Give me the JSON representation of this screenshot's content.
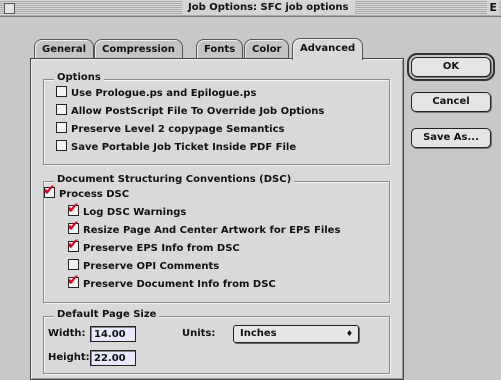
{
  "window": {
    "title": "Job Options: SFC job options",
    "zoom_glyph": "E"
  },
  "tabs": [
    {
      "label": "General"
    },
    {
      "label": "Compression"
    },
    {
      "label": "Fonts"
    },
    {
      "label": "Color"
    },
    {
      "label": "Advanced"
    }
  ],
  "options_group": {
    "title": "Options",
    "items": [
      {
        "label": "Use Prologue.ps and Epilogue.ps",
        "checked": false
      },
      {
        "label": "Allow PostScript File To Override Job Options",
        "checked": false
      },
      {
        "label": "Preserve Level 2 copypage Semantics",
        "checked": false
      },
      {
        "label": "Save Portable Job Ticket Inside PDF File",
        "checked": false
      }
    ]
  },
  "dsc_group": {
    "title": "Document Structuring Conventions (DSC)",
    "process": {
      "label": "Process DSC",
      "checked": true
    },
    "items": [
      {
        "label": "Log DSC Warnings",
        "checked": true
      },
      {
        "label": "Resize Page And Center Artwork for EPS Files",
        "checked": true
      },
      {
        "label": "Preserve EPS Info from DSC",
        "checked": true
      },
      {
        "label": "Preserve OPI Comments",
        "checked": false
      },
      {
        "label": "Preserve Document Info from DSC",
        "checked": true
      }
    ]
  },
  "page_size_group": {
    "title": "Default Page Size",
    "width_label": "Width:",
    "width_value": "14.00",
    "height_label": "Height:",
    "height_value": "22.00",
    "units_label": "Units:",
    "units_value": "Inches",
    "units_arrow": "♦"
  },
  "buttons": {
    "ok": "OK",
    "cancel": "Cancel",
    "save_as": "Save As..."
  },
  "check_glyph": "✔",
  "colors": {
    "check": "#d8001c",
    "field_bg": "#e8e8ff",
    "panel_bg": "#d9d9d9"
  }
}
